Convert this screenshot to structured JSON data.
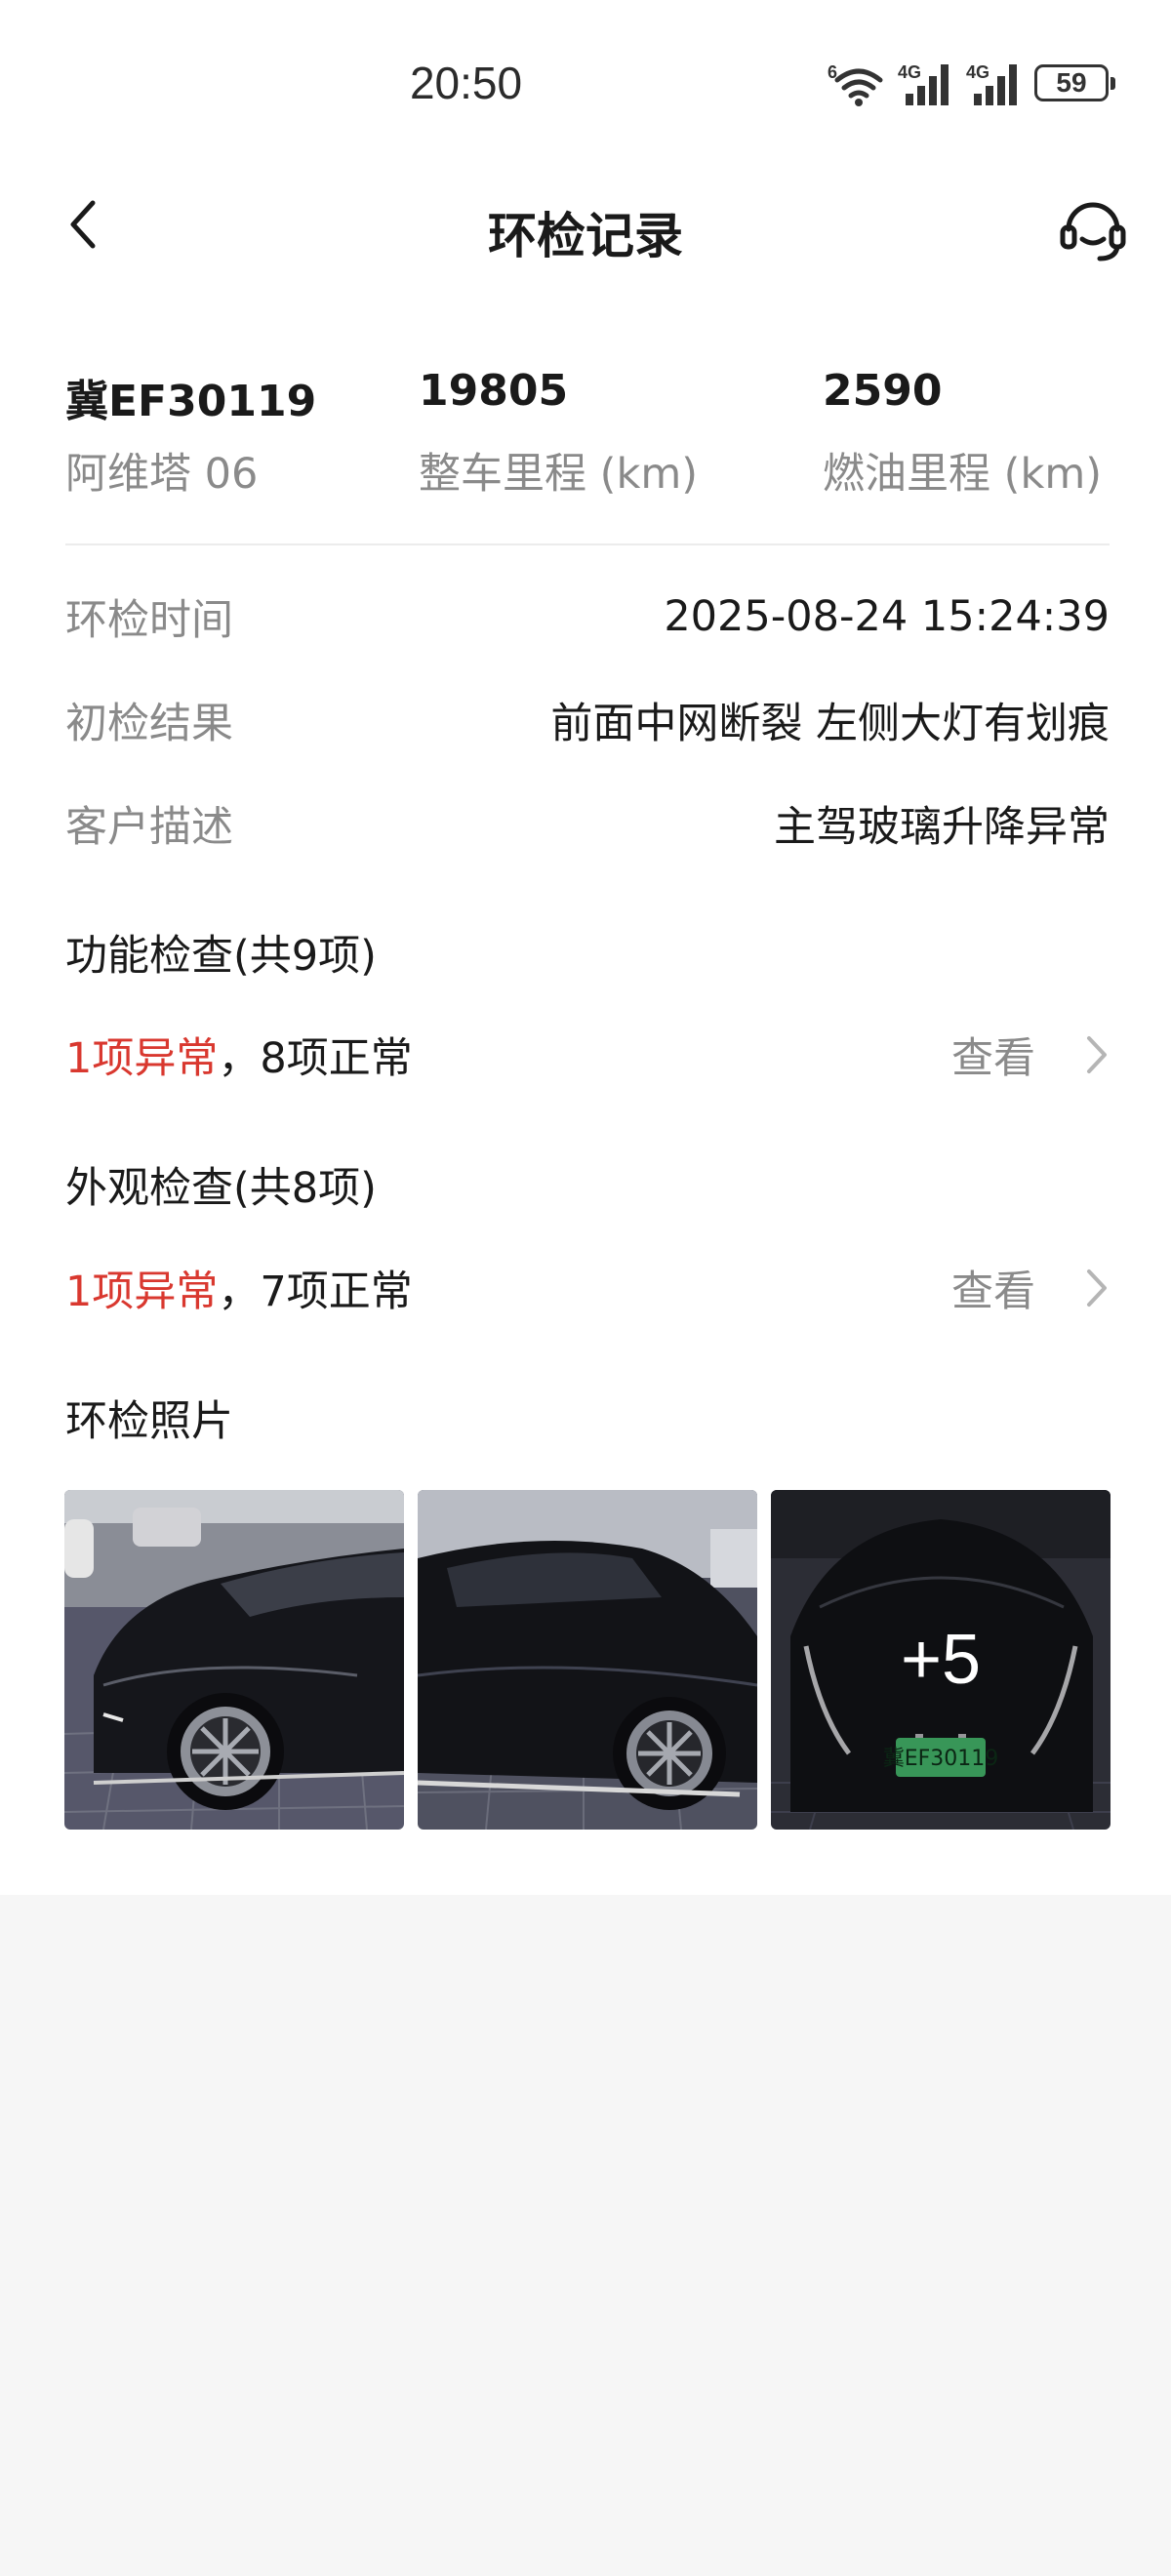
{
  "status_bar": {
    "time": "20:50",
    "wifi_tag": "6",
    "signal1_tag": "4G",
    "signal2_tag": "4G",
    "battery": "59"
  },
  "header": {
    "title": "环检记录",
    "back_icon": "chevron-left-icon",
    "service_icon": "headset-icon"
  },
  "vehicle": {
    "plate": "冀EF30119",
    "model": "阿维塔 06",
    "total_mileage": "19805",
    "total_mileage_label": "整车里程 (km)",
    "fuel_mileage": "2590",
    "fuel_mileage_label": "燃油里程 (km)"
  },
  "info": [
    {
      "label": "环检时间",
      "value": "2025-08-24 15:24:39"
    },
    {
      "label": "初检结果",
      "value": "前面中网断裂 左侧大灯有划痕"
    },
    {
      "label": "客户描述",
      "value": "主驾玻璃升降异常"
    }
  ],
  "function_check": {
    "title": "功能检查(共9项)",
    "abnormal": "1项异常",
    "separator": "，",
    "normal": "8项正常",
    "view_label": "查看"
  },
  "appearance_check": {
    "title": "外观检查(共8项)",
    "abnormal": "1项异常",
    "separator": "，",
    "normal": "7项正常",
    "view_label": "查看"
  },
  "photos": {
    "title": "环检照片",
    "more_count": "+5",
    "plate_text": "冀EF30119"
  },
  "colors": {
    "abnormal": "#d9382f",
    "secondary_text": "#8a8a8a",
    "page_background": "#f6f6f6"
  }
}
